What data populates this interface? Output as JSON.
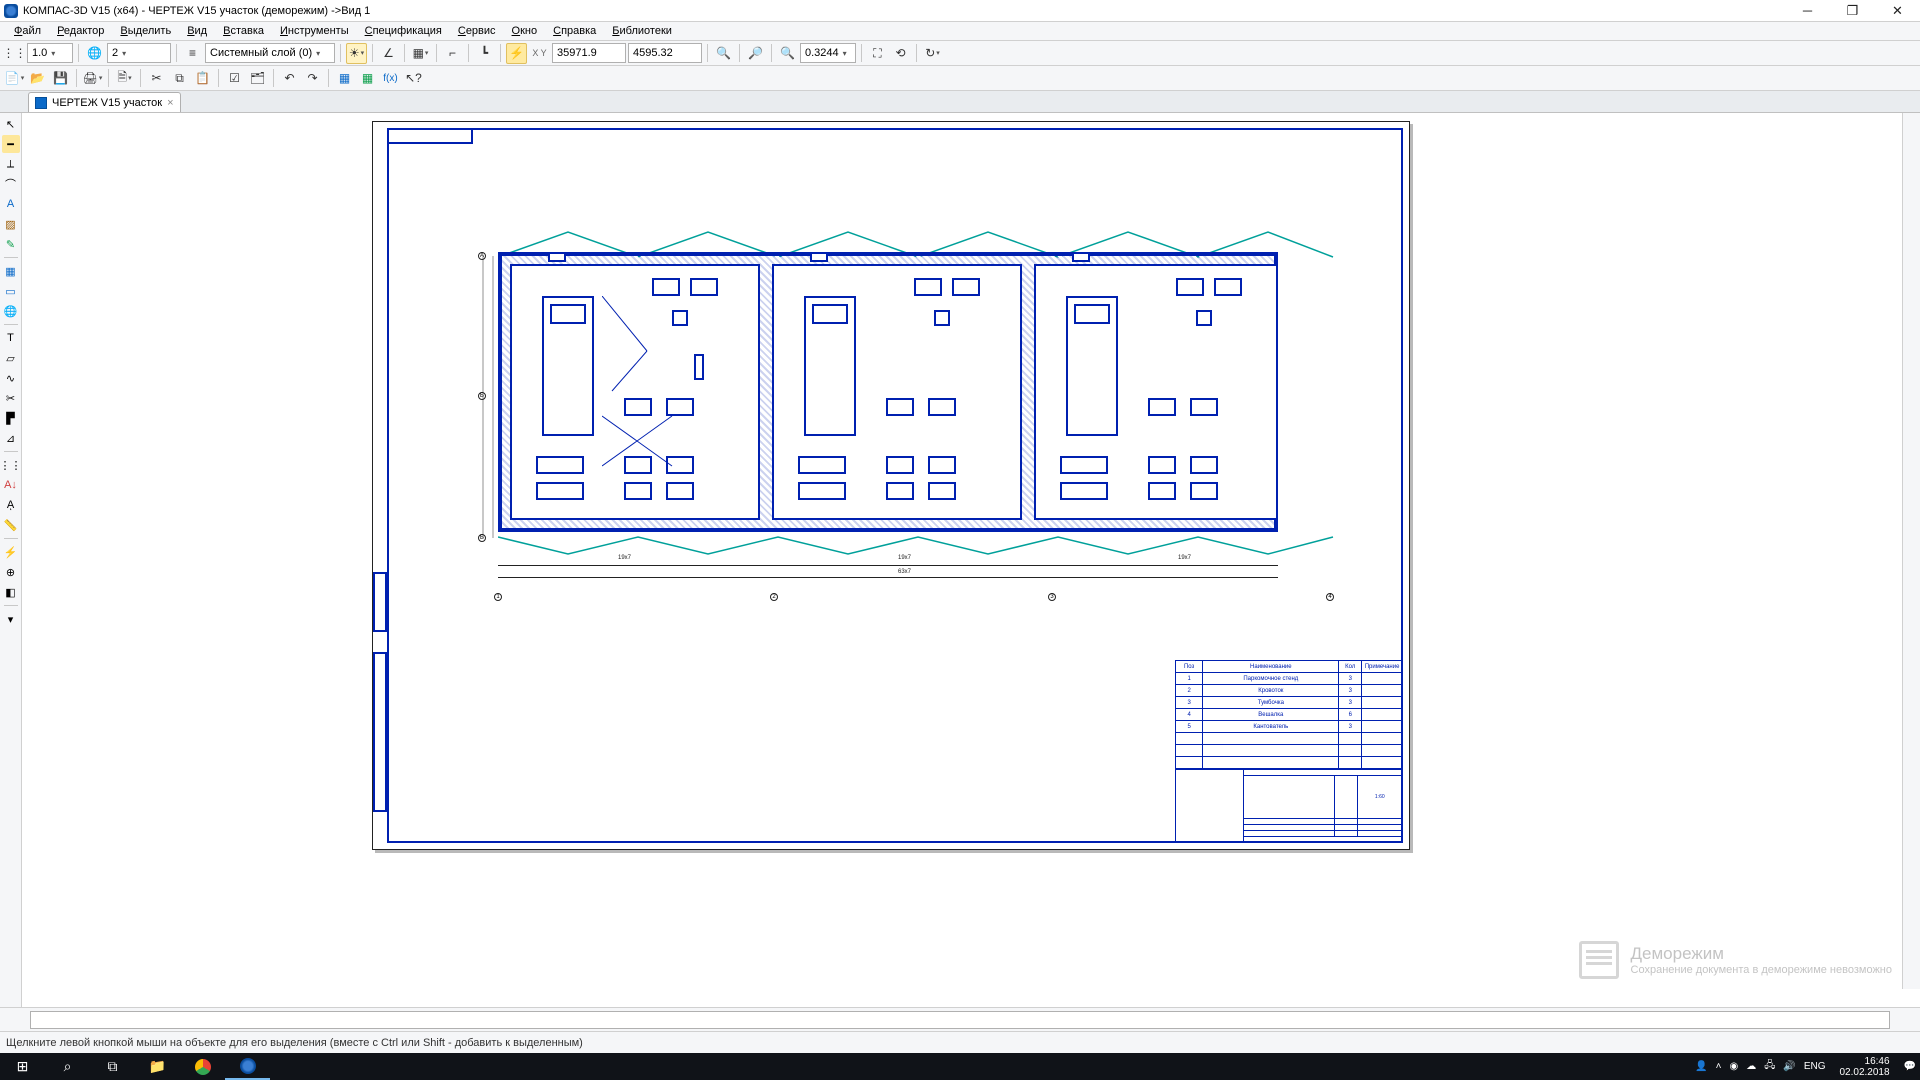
{
  "title": "КОМПАС-3D V15 (x64) - ЧЕРТЕЖ V15 участок (деморежим) ->Вид 1",
  "menu": [
    "Файл",
    "Редактор",
    "Выделить",
    "Вид",
    "Вставка",
    "Инструменты",
    "Спецификация",
    "Сервис",
    "Окно",
    "Справка",
    "Библиотеки"
  ],
  "tb1": {
    "step": "1.0",
    "view_no": "2",
    "layer": "Системный слой (0)",
    "coord_x": "35971.9",
    "coord_y": "4595.32",
    "zoom": "0.3244",
    "xy_label": "X Y"
  },
  "doctab": {
    "label": "ЧЕРТЕЖ V15 участок"
  },
  "status": "Щелкните левой кнопкой мыши на объекте для его выделения (вместе с Ctrl или Shift - добавить к выделенным)",
  "demo": {
    "title": "Деморежим",
    "sub": "Сохранение документа в деморежиме невозможно"
  },
  "spec": {
    "headers": [
      "Поз",
      "Наименование",
      "Кол",
      "Примечание"
    ],
    "rows": [
      {
        "n": "1",
        "name": "Паркомочное стенд",
        "q": "3"
      },
      {
        "n": "2",
        "name": "Кровоток",
        "q": "3"
      },
      {
        "n": "3",
        "name": "Тумбочка",
        "q": "3"
      },
      {
        "n": "4",
        "name": "Вешалка",
        "q": "6"
      },
      {
        "n": "5",
        "name": "Кантователь",
        "q": "3"
      }
    ]
  },
  "dims": {
    "a": "А",
    "b": "Б",
    "c": "1",
    "d": "2",
    "e": "3",
    "f": "4",
    "span": "19x7",
    "total": "63х7"
  },
  "taskbar": {
    "lang": "ENG",
    "time": "16:46",
    "date": "02.02.2018"
  }
}
